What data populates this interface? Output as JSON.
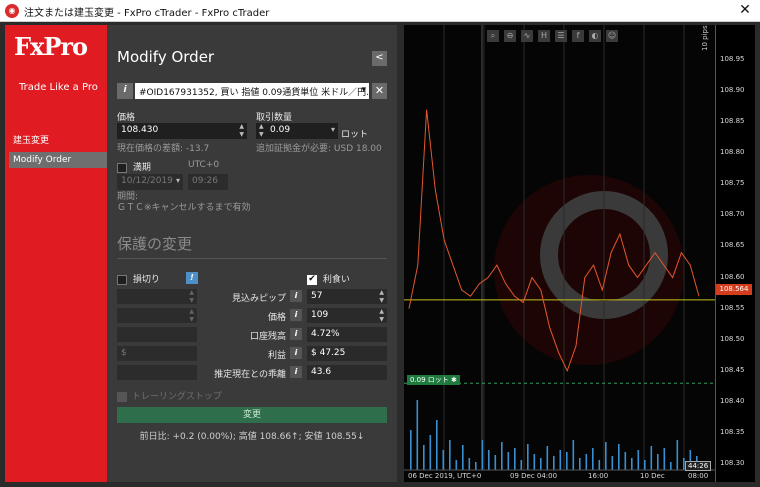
{
  "window": {
    "title": "注文または建玉変更 - FxPro cTrader - FxPro cTrader",
    "close": "✕"
  },
  "brand": {
    "logo": "FxPro",
    "tagline": "Trade Like a Pro"
  },
  "nav": {
    "items": [
      "建玉変更",
      "Modify Order"
    ],
    "active": "Modify Order"
  },
  "form": {
    "heading": "Modify Order",
    "order_select": "#OID167931352, 買い 指値 0.09通貨単位 米ドル／円…",
    "price_label": "価格",
    "price_value": "108.430",
    "price_note": "現在価格の差額: -13.7",
    "qty_label": "取引数量",
    "qty_value": "0.09",
    "qty_unit": "ロット",
    "qty_note": "追加証拠金が必要: USD 18.00",
    "expiry_label": "満期",
    "expiry_tz": "UTC+0",
    "expiry_date": "10/12/2019",
    "expiry_time": "09:26",
    "period_label": "期間:",
    "period_value": "ＧＴＣ※キャンセルするまで有効",
    "protection_heading": "保護の変更",
    "sl_label": "損切り",
    "sl_info": "!",
    "tp_label": "利食い",
    "rows": [
      {
        "label": "見込みピップ",
        "value": "57"
      },
      {
        "label": "価格",
        "value": "109"
      },
      {
        "label": "口座残高",
        "value": "4.72%"
      },
      {
        "label": "利益",
        "value": "$ 47.25"
      },
      {
        "label": "推定現在との乖離",
        "value": "43.6"
      }
    ],
    "sl_currency": "$",
    "trailing_label": "トレーリングストップ",
    "submit": "変更",
    "summary": "前日比: +0.2 (0.00%); 高値 108.66↑; 安値 108.55↓"
  },
  "chart_data": {
    "type": "line",
    "current_price": "108.564",
    "pips_label": "10 pips",
    "order_tag": "0.09 ロット",
    "y_ticks": [
      "108.95",
      "108.90",
      "108.85",
      "108.80",
      "108.75",
      "108.70",
      "108.65",
      "108.60",
      "108.55",
      "108.50",
      "108.45",
      "108.40",
      "108.35",
      "108.30"
    ],
    "x_labels": [
      "06 Dec 2019, UTC+0",
      "09 Dec 04:00",
      "16:00",
      "10 Dec",
      "08:00"
    ],
    "cursor_label": "44:26",
    "series": [
      {
        "values": [
          108.55,
          108.62,
          108.87,
          108.74,
          108.66,
          108.62,
          108.58,
          108.57,
          108.59,
          108.6,
          108.62,
          108.59,
          108.57,
          108.56,
          108.6,
          108.58,
          108.52,
          108.48,
          108.45,
          108.49,
          108.6,
          108.62,
          108.58,
          108.64,
          108.67,
          108.62,
          108.6,
          108.62,
          108.64,
          108.62,
          108.6,
          108.64,
          108.62,
          108.57
        ]
      }
    ],
    "volume": [
      40,
      70,
      25,
      35,
      50,
      20,
      30,
      10,
      25,
      12,
      8,
      30,
      20,
      15,
      28,
      18,
      22,
      10,
      26,
      16,
      12,
      24,
      14,
      20,
      18,
      30,
      12,
      16,
      22,
      10,
      28,
      14,
      26,
      18,
      12,
      20,
      10,
      24,
      16,
      22,
      8,
      30,
      12,
      20,
      14
    ]
  },
  "toolbar_icons": [
    "zoom-icon",
    "zoom-out-icon",
    "chart-icon",
    "h1-icon",
    "list-icon",
    "facebook-icon",
    "sentiment-icon",
    "user-icon"
  ]
}
